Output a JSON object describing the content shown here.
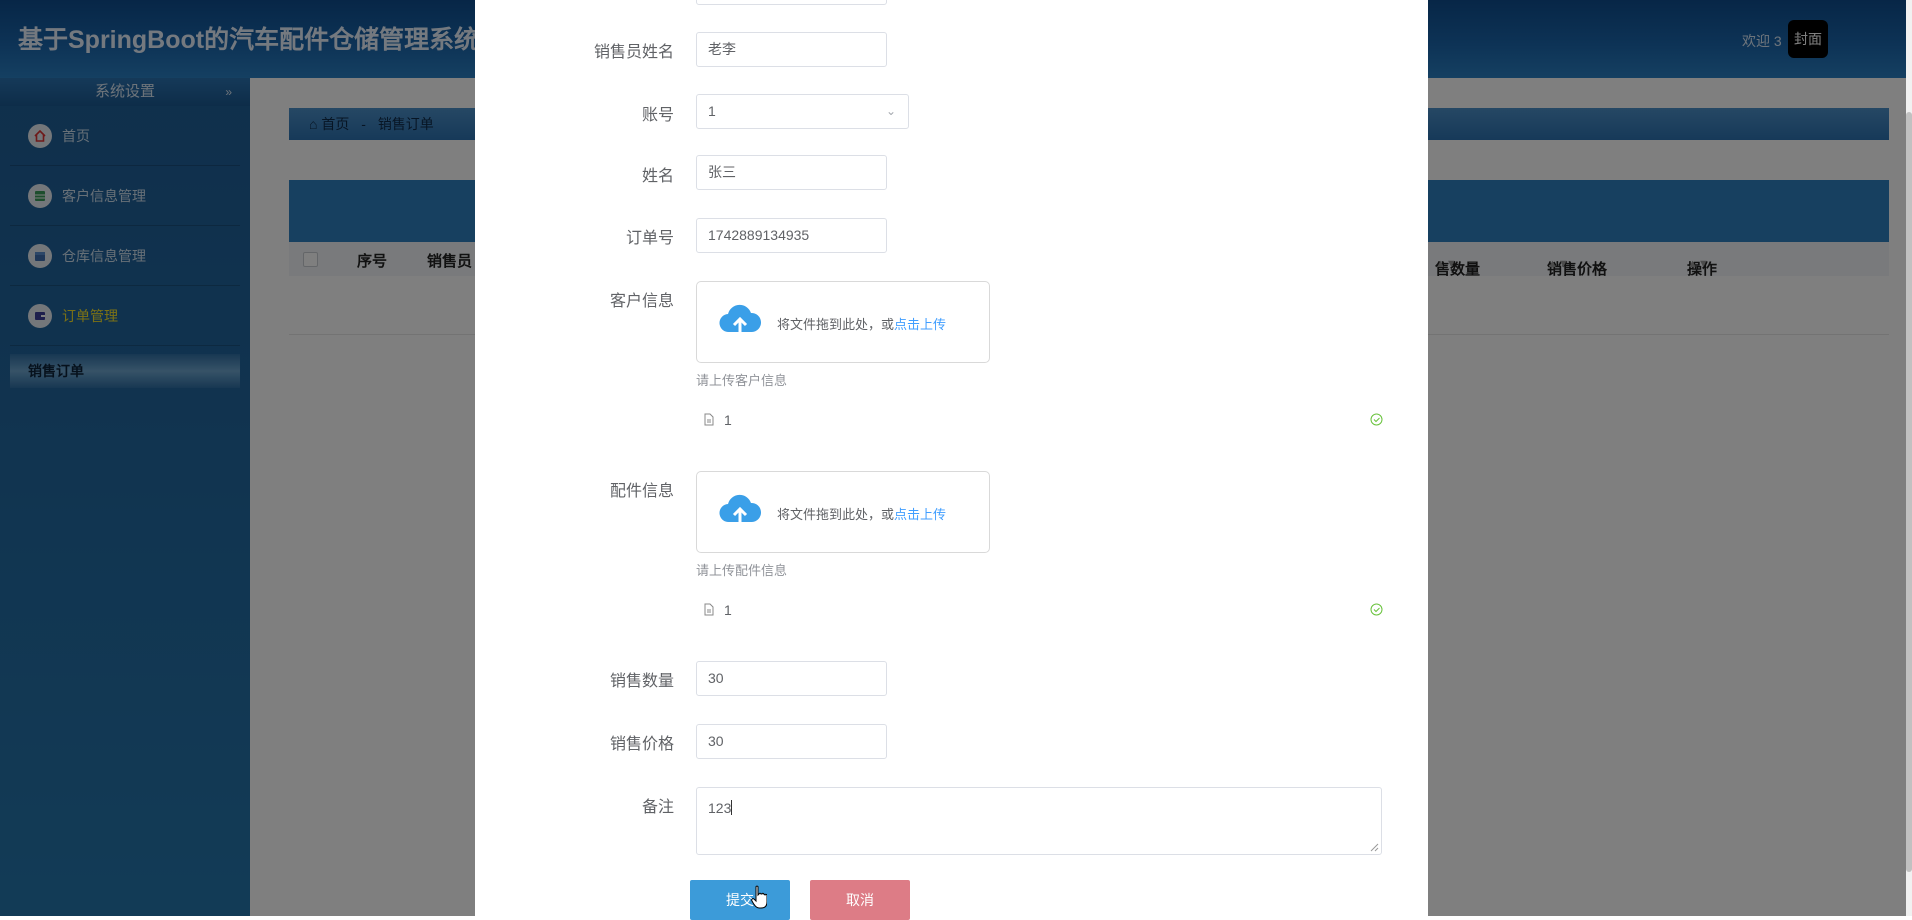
{
  "header": {
    "app_title": "基于SpringBoot的汽车配件仓储管理系统设",
    "welcome": "欢迎 3",
    "cover_button": "封面"
  },
  "sidebar": {
    "section_title": "系统设置",
    "items": [
      {
        "label": "首页",
        "icon": "home-icon"
      },
      {
        "label": "客户信息管理",
        "icon": "customer-icon"
      },
      {
        "label": "仓库信息管理",
        "icon": "warehouse-icon"
      },
      {
        "label": "订单管理",
        "icon": "order-icon"
      }
    ],
    "active_sub": "销售订单"
  },
  "breadcrumb": {
    "home": "首页",
    "separator": "-",
    "current": "销售订单"
  },
  "table": {
    "headers": [
      "序号",
      "销售员",
      "售数量",
      "销售价格",
      "操作"
    ]
  },
  "form": {
    "salesperson_name": {
      "label": "销售员姓名",
      "value": "老李"
    },
    "account": {
      "label": "账号",
      "value": "1"
    },
    "name": {
      "label": "姓名",
      "value": "张三"
    },
    "order_no": {
      "label": "订单号",
      "value": "1742889134935"
    },
    "customer_info": {
      "label": "客户信息",
      "drop_text": "将文件拖到此处，或",
      "drop_link": "点击上传",
      "tip": "请上传客户信息",
      "file_name": "1"
    },
    "parts_info": {
      "label": "配件信息",
      "drop_text": "将文件拖到此处，或",
      "drop_link": "点击上传",
      "tip": "请上传配件信息",
      "file_name": "1"
    },
    "sales_qty": {
      "label": "销售数量",
      "value": "30"
    },
    "sales_price": {
      "label": "销售价格",
      "value": "30"
    },
    "remark": {
      "label": "备注",
      "value": "123"
    },
    "submit_label": "提交",
    "cancel_label": "取消"
  },
  "colors": {
    "primary": "#409eff",
    "submit": "#3c9bd9",
    "cancel": "#dd7c86",
    "success": "#67c23a",
    "active_menu": "#f6e32b"
  }
}
